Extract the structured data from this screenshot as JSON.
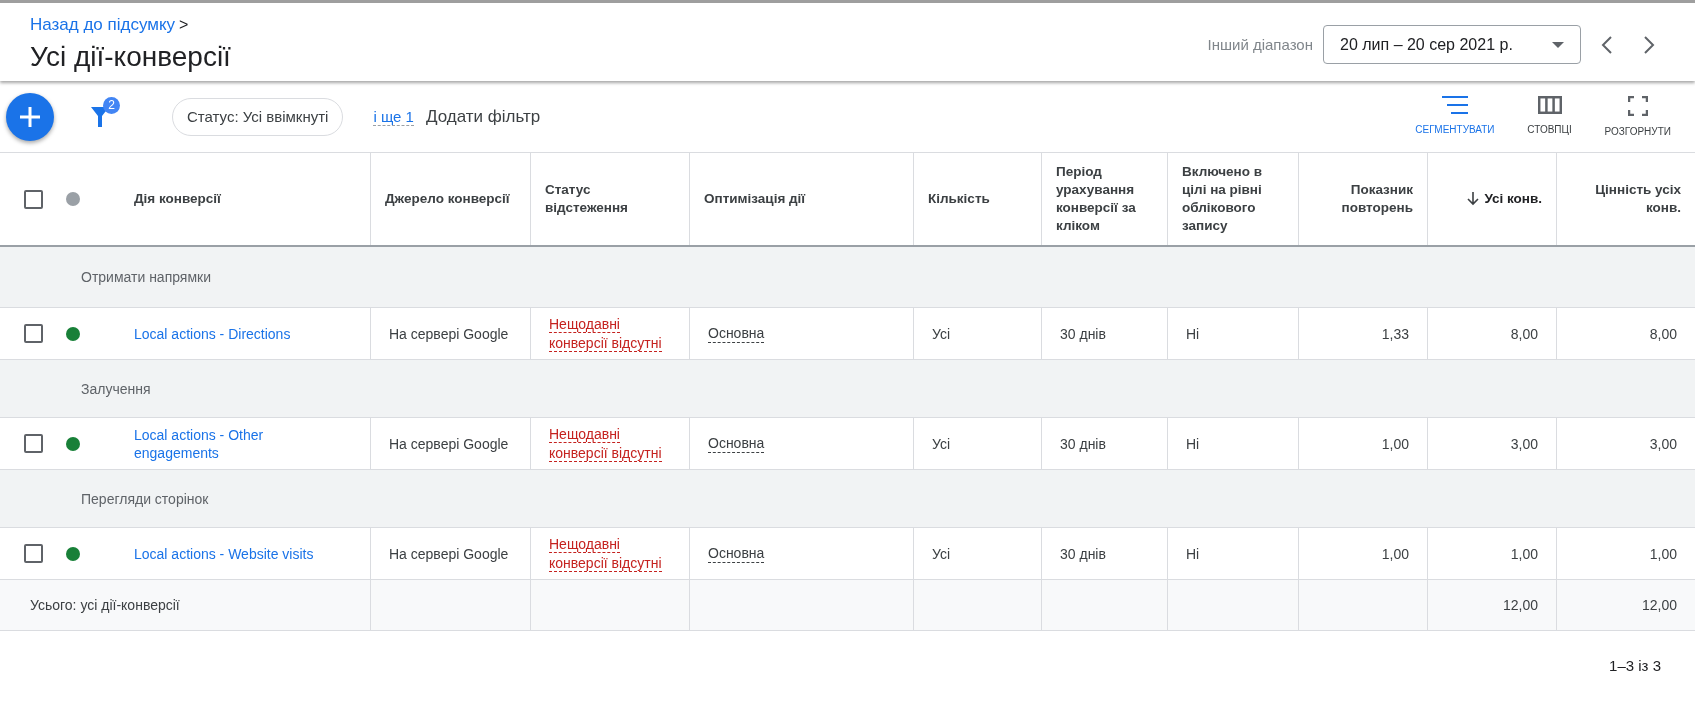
{
  "header": {
    "back_link": "Назад до підсумку",
    "back_chevron": ">",
    "title": "Усі дії-конверсії",
    "range_label": "Інший діапазон",
    "date_range": "20 лип – 20 сер 2021 р."
  },
  "toolbar": {
    "filter_count": "2",
    "filter_chip": "Статус: Усі ввімкнуті",
    "more_filters": "і ще 1",
    "add_filter": "Додати фільтр",
    "actions": [
      {
        "kind": "segment",
        "label": "СЕГМЕНТУВАТИ",
        "active": true
      },
      {
        "kind": "columns",
        "label": "СТОВПЦІ",
        "active": false
      },
      {
        "kind": "expand",
        "label": "РОЗГОРНУТИ",
        "active": false
      }
    ]
  },
  "table": {
    "header_checkbox": {
      "checked": false
    },
    "header_dot": {
      "color": "#9aa0a6"
    },
    "columns": [
      {
        "label": "Дія конверсії",
        "kind": "link",
        "sorted": false
      },
      {
        "label": "Джерело конверсії",
        "kind": "text",
        "sorted": false
      },
      {
        "label": "Статус відстеження",
        "kind": "warning",
        "sorted": false
      },
      {
        "label": "Оптимізація дії",
        "kind": "dashed",
        "sorted": false
      },
      {
        "label": "Кількість",
        "kind": "text",
        "sorted": false
      },
      {
        "label": "Період урахування конверсії за кліком",
        "kind": "text",
        "sorted": false
      },
      {
        "label": "Включено в цілі на рівні облікового запису",
        "kind": "text",
        "sorted": false
      },
      {
        "label": "Показник повторень",
        "kind": "number",
        "sorted": false
      },
      {
        "label": "Усі конв.",
        "kind": "number",
        "sorted": true
      },
      {
        "label": "Цінність усіх конв.",
        "kind": "number",
        "sorted": false
      }
    ],
    "groups": [
      {
        "name": "Отримати напрямки",
        "rows": [
          {
            "checked": false,
            "color": "#188038",
            "cells": [
              "Local actions - Directions",
              "На сервері Google",
              "Нещодавні конверсії відсутні",
              "Основна",
              "Усі",
              "30 днів",
              "Ні",
              "1,33",
              "8,00",
              "8,00"
            ]
          }
        ]
      },
      {
        "name": "Залучення",
        "rows": [
          {
            "checked": false,
            "color": "#188038",
            "cells": [
              "Local actions - Other engagements",
              "На сервері Google",
              "Нещодавні конверсії відсутні",
              "Основна",
              "Усі",
              "30 днів",
              "Ні",
              "1,00",
              "3,00",
              "3,00"
            ]
          }
        ]
      },
      {
        "name": "Перегляди сторінок",
        "rows": [
          {
            "checked": false,
            "color": "#188038",
            "cells": [
              "Local actions - Website visits",
              "На сервері Google",
              "Нещодавні конверсії відсутні",
              "Основна",
              "Усі",
              "30 днів",
              "Ні",
              "1,00",
              "1,00",
              "1,00"
            ]
          }
        ]
      }
    ],
    "total": {
      "label": "Усього: усі дії-конверсії",
      "cells": [
        "",
        "",
        "",
        "",
        "",
        "",
        "",
        "12,00",
        "12,00"
      ]
    }
  },
  "pagination": "1–3 із 3"
}
